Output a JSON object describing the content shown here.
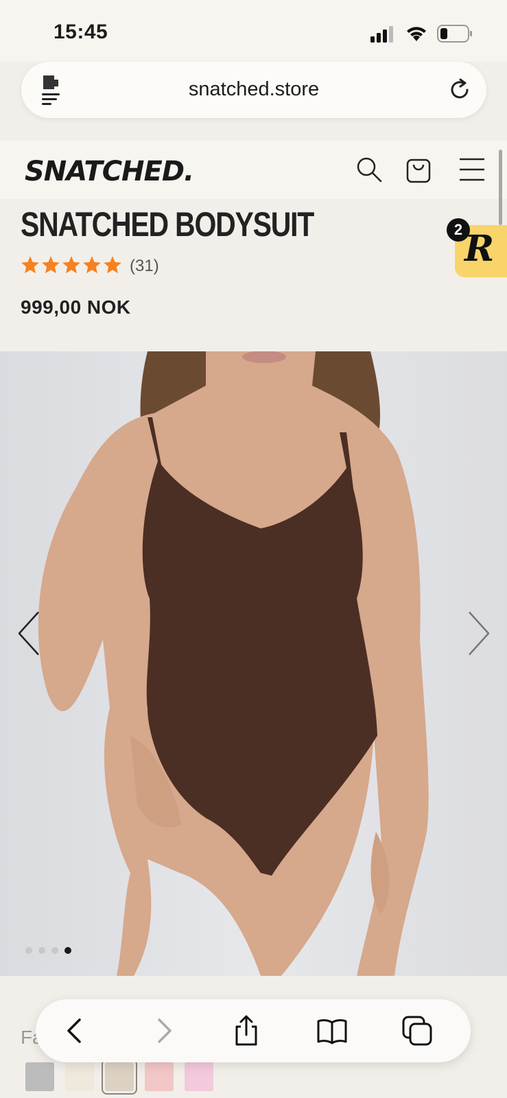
{
  "status_bar": {
    "time": "15:45"
  },
  "browser": {
    "url": "snatched.store"
  },
  "site": {
    "brand": "SNATCHED.",
    "icons": [
      "search-icon",
      "cart-icon",
      "menu-icon"
    ]
  },
  "product": {
    "title": "SNATCHED BODYSUIT",
    "rating_stars": 5,
    "review_count": "(31)",
    "price": "999,00 NOK"
  },
  "reviews_badge": {
    "count": "2",
    "letter": "R"
  },
  "gallery": {
    "total_slides": 4,
    "active_slide": 4
  },
  "color": {
    "label": "Fa",
    "swatches": [
      "#bdbcbc",
      "#eee9dc",
      "#dcd1c3",
      "#f2c7c6",
      "#f3c9dc"
    ],
    "selected_index": 2
  },
  "safari_toolbar": {
    "buttons": [
      "back-icon",
      "forward-icon",
      "share-icon",
      "bookmarks-icon",
      "tabs-icon"
    ]
  },
  "colors": {
    "accent_star": "#f5821f",
    "badge_yellow": "#f8d46a",
    "bodysuit": "#4b2e24"
  }
}
